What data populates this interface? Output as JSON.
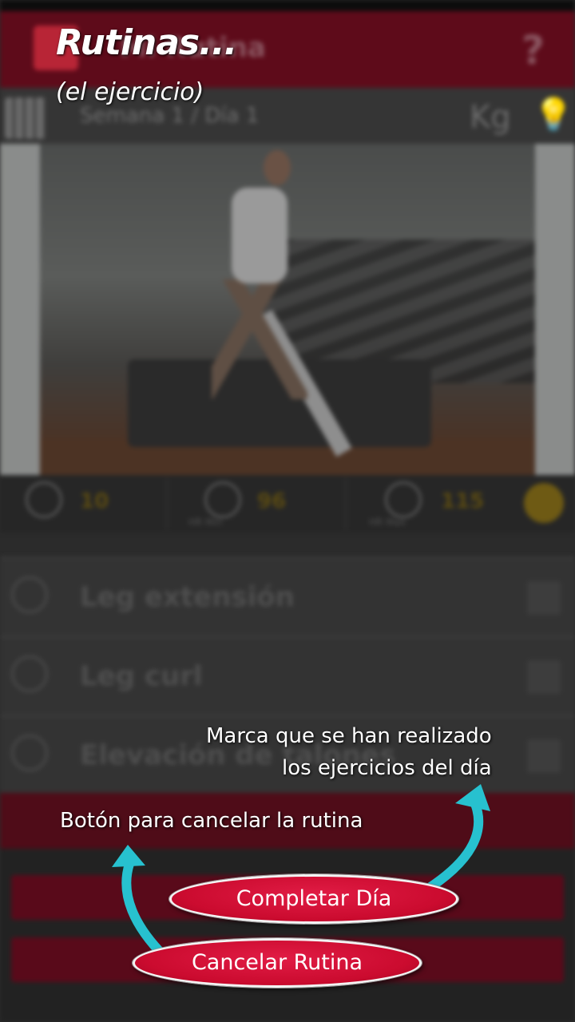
{
  "app_bar": {
    "title": "Mi Rutina"
  },
  "sub_bar": {
    "week_label": "Semana 1 / Día 1",
    "unit": "Kg"
  },
  "stats": [
    {
      "value": "10",
      "label": ""
    },
    {
      "value": "96",
      "label": "HR Min"
    },
    {
      "value": "115",
      "label": "HR Max"
    }
  ],
  "exercises": [
    {
      "label": "Leg extensión"
    },
    {
      "label": "Leg curl"
    },
    {
      "label": "Elevación de talones"
    }
  ],
  "overlay": {
    "title": "Rutinas...",
    "subtitle": "(el ejercicio)",
    "note_complete_line1": "Marca que se han realizado",
    "note_complete_line2": "los ejercicios del día",
    "note_cancel": "Botón para cancelar la rutina"
  },
  "buttons": {
    "complete_day": "Completar Día",
    "cancel_routine": "Cancelar Rutina"
  },
  "colors": {
    "accent_red": "#cb0b2f",
    "arrow_cyan": "#27c1cf",
    "app_bar_dim": "#5e0b1a"
  }
}
